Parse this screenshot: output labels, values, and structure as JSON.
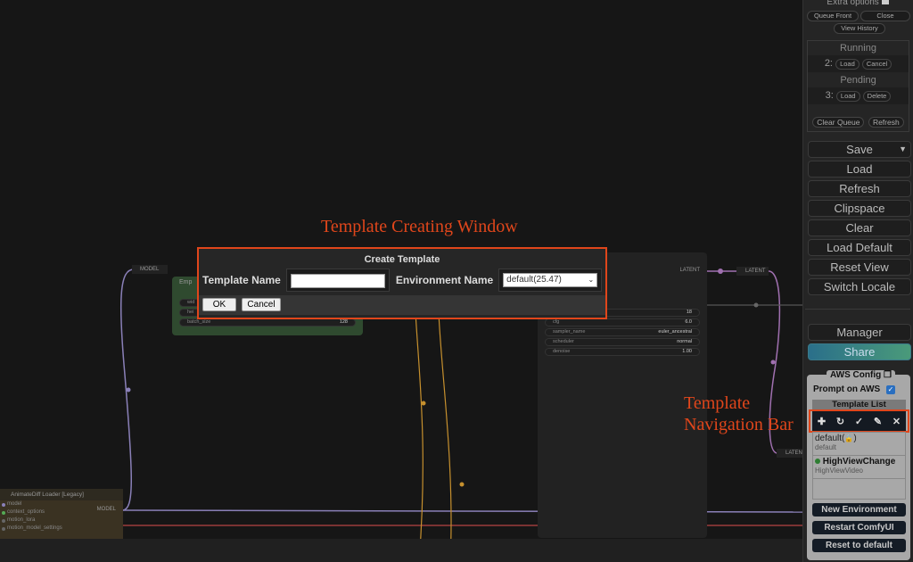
{
  "annotations": {
    "creating_window": "Template Creating Window",
    "nav_bar": "Template Navigation Bar"
  },
  "menu": {
    "extra_options": "Extra options",
    "queue_front": "Queue Front",
    "close": "Close",
    "view_history": "View History",
    "running": "Running",
    "running_index": "2:",
    "load": "Load",
    "cancel": "Cancel",
    "pending": "Pending",
    "pending_index": "3:",
    "delete": "Delete",
    "clear_queue": "Clear Queue",
    "refresh_small": "Refresh",
    "buttons": [
      "Save",
      "Load",
      "Refresh",
      "Clipspace",
      "Clear",
      "Load Default",
      "Reset View",
      "Switch Locale"
    ],
    "manager": "Manager",
    "share": "Share"
  },
  "aws": {
    "title": "AWS Config",
    "prompt_on_aws": "Prompt on AWS",
    "prompt_checked": true,
    "template_list": "Template List",
    "nav_icons": [
      "plus-icon",
      "refresh-icon",
      "check-icon",
      "pencil-icon",
      "close-icon"
    ],
    "templates": [
      {
        "name": "default(",
        "suffix": ")",
        "sub": "default",
        "locked": true,
        "active": false
      },
      {
        "name": "HighViewChange",
        "sub": "HighViewVideo",
        "locked": false,
        "active": true
      }
    ],
    "new_env": "New Environment",
    "restart": "Restart ComfyUI",
    "reset": "Reset to default",
    "active_color": "#2e7d32"
  },
  "dialog": {
    "title": "Create Template",
    "template_name_label": "Template Name",
    "template_name_value": "",
    "env_label": "Environment Name",
    "env_value": "default(25.47)",
    "ok": "OK",
    "cancel": "Cancel",
    "border_color": "#e0461b"
  },
  "nodes": {
    "model_label": "MODEL",
    "latent_node": {
      "title": "Emp",
      "w1": "wid",
      "w2": "hei",
      "batch_label": "batch_size",
      "batch_value": "128"
    },
    "sampler": {
      "latent": "LATENT",
      "rows": [
        [
          "",
          "18"
        ],
        [
          "cfg",
          "6.0"
        ],
        [
          "sampler_name",
          "euler_ancestral"
        ],
        [
          "scheduler",
          "normal"
        ],
        [
          "denoise",
          "1.00"
        ]
      ]
    },
    "reroute_latent": "LATENT",
    "bottom_latent": "LATEN",
    "animatediff": {
      "title": "AnimateDiff Loader [Legacy]",
      "output": "MODEL",
      "inputs": [
        "model",
        "context_options",
        "motion_lora",
        "motion_model_settings"
      ]
    }
  }
}
